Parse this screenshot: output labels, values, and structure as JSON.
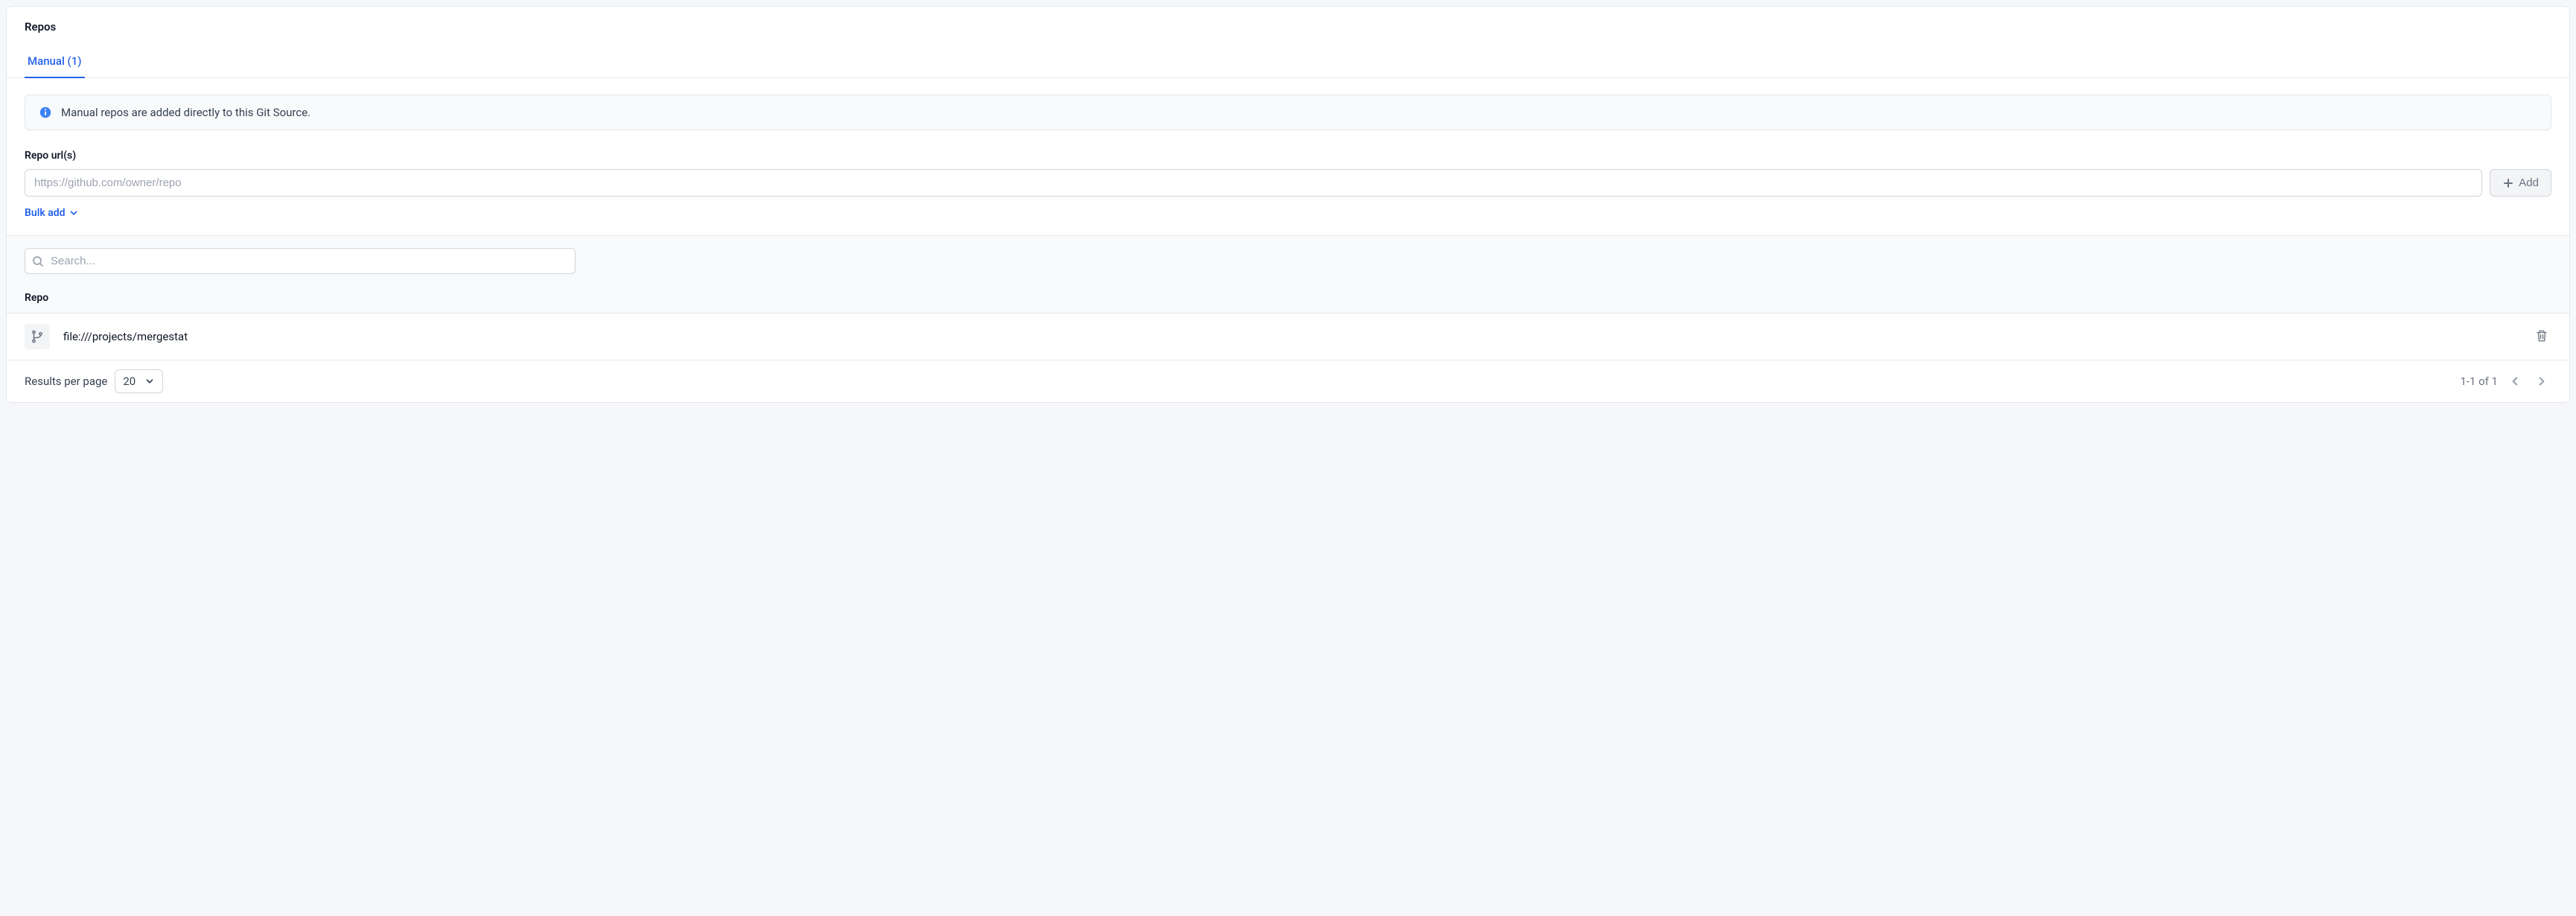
{
  "header": {
    "title": "Repos"
  },
  "tabs": [
    {
      "label": "Manual (1)",
      "active": true
    }
  ],
  "alert": {
    "text": "Manual repos are added directly to this Git Source."
  },
  "repo_url_section": {
    "label": "Repo url(s)",
    "placeholder": "https://github.com/owner/repo",
    "value": "",
    "add_button_label": "Add",
    "bulk_add_label": "Bulk add"
  },
  "table": {
    "search_placeholder": "Search...",
    "column_header": "Repo",
    "rows": [
      {
        "path": "file:///projects/mergestat"
      }
    ]
  },
  "pagination": {
    "results_label": "Results per page",
    "page_size": "20",
    "range_text": "1-1 of 1"
  }
}
